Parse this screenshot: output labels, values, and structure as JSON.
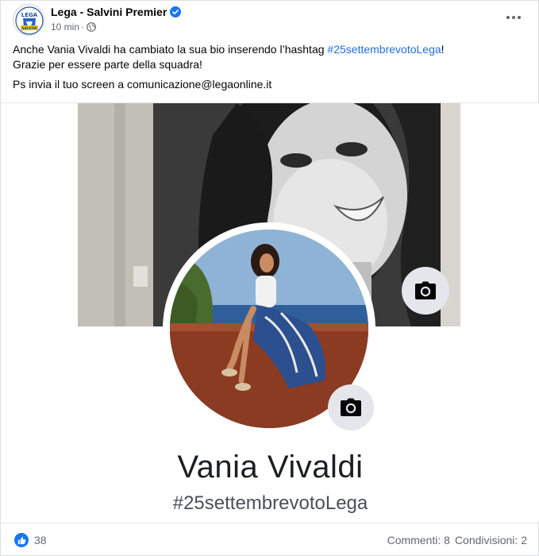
{
  "post": {
    "author": "Lega - Salvini Premier",
    "timestamp": "10 min",
    "separator": "·",
    "verified_icon": "verified-badge-icon",
    "privacy_icon": "globe-icon",
    "more_icon": "more-options-icon",
    "avatar_logo_text": "LEGA",
    "avatar_banner_text": "SALVINI",
    "text": {
      "line1_before": "Anche Vania Vivaldi ha cambiato la sua bio inserendo l’hashtag ",
      "line1_hashtag": "#25settembrevotoLega",
      "line1_after": "!",
      "line2": "Grazie per essere parte della squadra!",
      "line3": "Ps invia il tuo screen a comunicazione@legaonline.it"
    }
  },
  "profile_screenshot": {
    "name": "Vania Vivaldi",
    "bio": "#25settembrevotoLega",
    "cover_camera_icon": "camera-icon",
    "profile_camera_icon": "camera-icon"
  },
  "footer": {
    "like_icon": "like-thumb-icon",
    "reactions_count": "38",
    "comments": "Commenti: 8",
    "shares": "Condivisioni: 2"
  },
  "colors": {
    "link": "#216fdb",
    "like_blue": "#1877f2",
    "secondary_text": "#65676b"
  }
}
